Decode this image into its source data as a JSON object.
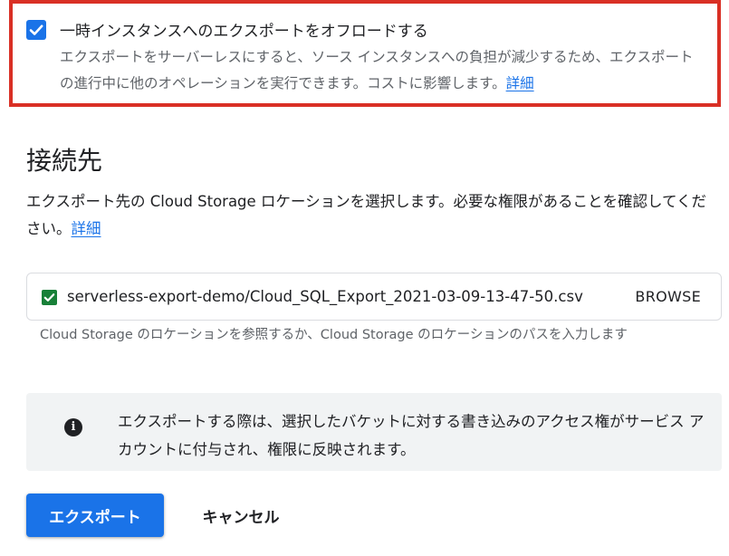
{
  "offload": {
    "checked": true,
    "title": "一時インスタンスへのエクスポートをオフロードする",
    "description": "エクスポートをサーバーレスにすると、ソース インスタンスへの負担が減少するため、エクスポートの進行中に他のオペレーションを実行できます。コストに影響します。",
    "learn_more": "詳細"
  },
  "destination": {
    "heading": "接続先",
    "description": "エクスポート先の Cloud Storage ロケーションを選択します。必要な権限があることを確認してください。",
    "learn_more": "詳細",
    "path_value": "serverless-export-demo/Cloud_SQL_Export_2021-03-09-13-47-50.csv",
    "path_valid_icon": "check-icon",
    "browse_label": "BROWSE",
    "helper_text": "Cloud Storage のロケーションを参照するか、Cloud Storage のロケーションのパスを入力します"
  },
  "info": {
    "icon": "info-icon",
    "text": "エクスポートする際は、選択したバケットに対する書き込みのアクセス権がサービス アカウントに付与され、権限に反映されます。"
  },
  "actions": {
    "export_label": "エクスポート",
    "cancel_label": "キャンセル"
  },
  "colors": {
    "primary": "#1a73e8",
    "success": "#188038",
    "highlight_border": "#d93025"
  }
}
